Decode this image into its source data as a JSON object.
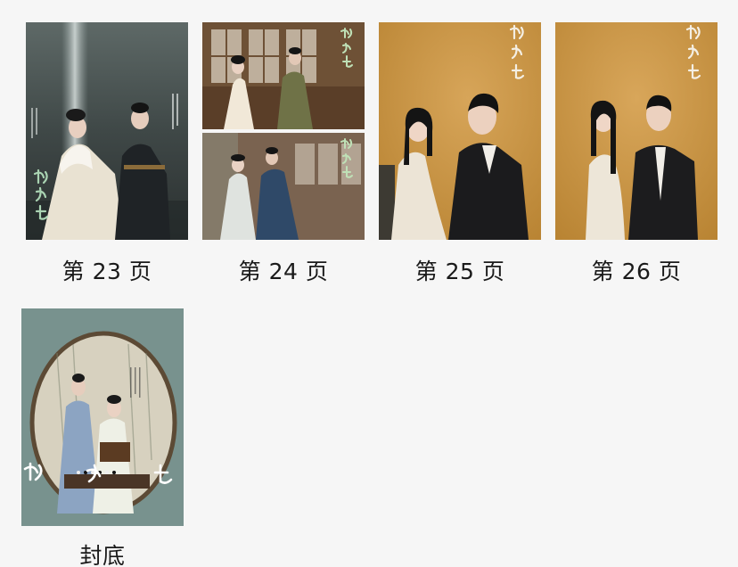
{
  "pages": [
    {
      "label": "第 23 页"
    },
    {
      "label": "第 24 页"
    },
    {
      "label": "第 25 页"
    },
    {
      "label": "第 26 页"
    },
    {
      "label": "封底"
    }
  ]
}
